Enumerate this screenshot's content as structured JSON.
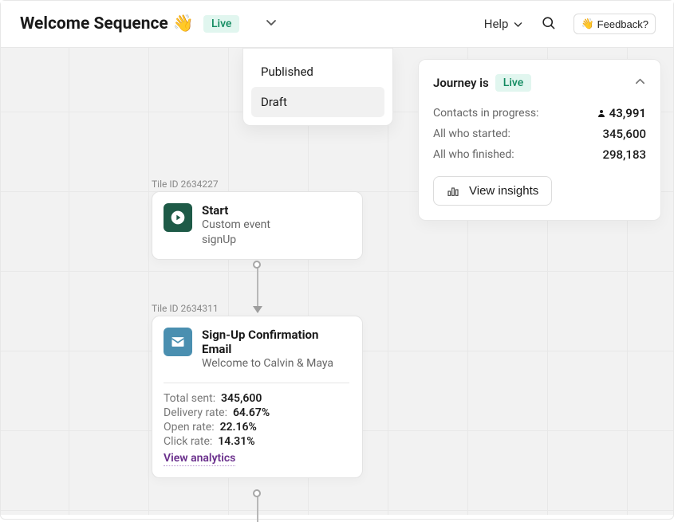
{
  "header": {
    "title": "Welcome Sequence",
    "emoji": "👋",
    "status": "Live",
    "help": "Help",
    "feedback": "Feedback?"
  },
  "dropdown": {
    "published": "Published",
    "draft": "Draft"
  },
  "journey": {
    "label": "Journey is",
    "status": "Live",
    "stats": {
      "contacts_label": "Contacts in progress:",
      "contacts_value": "43,991",
      "started_label": "All who started:",
      "started_value": "345,600",
      "finished_label": "All who finished:",
      "finished_value": "298,183"
    },
    "insights_label": "View insights"
  },
  "tiles": {
    "start": {
      "id_label": "Tile ID 2634227",
      "title": "Start",
      "subtitle": "Custom event",
      "event": "signUp"
    },
    "email": {
      "id_label": "Tile ID 2634311",
      "title": "Sign-Up Confirmation Email",
      "subtitle": "Welcome to Calvin & Maya",
      "stats": {
        "total_sent_label": "Total sent:",
        "total_sent_value": "345,600",
        "delivery_label": "Delivery rate:",
        "delivery_value": "64.67%",
        "open_label": "Open rate:",
        "open_value": "22.16%",
        "click_label": "Click rate:",
        "click_value": "14.31%"
      },
      "view_analytics": "View analytics"
    }
  }
}
